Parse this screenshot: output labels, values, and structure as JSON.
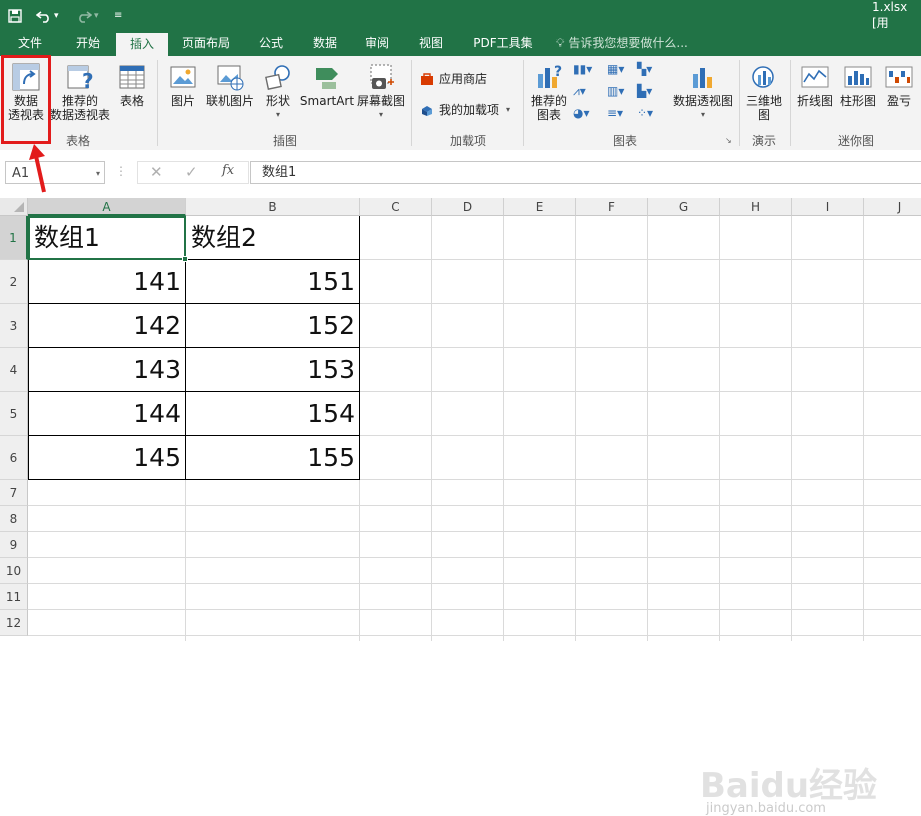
{
  "title_bar": {
    "filename": "1.xlsx [用"
  },
  "tabs": [
    {
      "label": "文件"
    },
    {
      "label": "开始"
    },
    {
      "label": "插入"
    },
    {
      "label": "页面布局"
    },
    {
      "label": "公式"
    },
    {
      "label": "数据"
    },
    {
      "label": "审阅"
    },
    {
      "label": "视图"
    },
    {
      "label": "PDF工具集"
    }
  ],
  "tell_me": "告诉我您想要做什么...",
  "ribbon": {
    "pivot_table": {
      "line1": "数据",
      "line2": "透视表"
    },
    "recommended_pivot": {
      "line1": "推荐的",
      "line2": "数据透视表"
    },
    "table": "表格",
    "group_tables": "表格",
    "picture": "图片",
    "online_picture": "联机图片",
    "shapes": "形状",
    "smartart": "SmartArt",
    "screenshot": "屏幕截图",
    "group_illustrations": "插图",
    "store": "应用商店",
    "my_addins": "我的加载项",
    "group_addins": "加载项",
    "recommended_charts": {
      "line1": "推荐的",
      "line2": "图表"
    },
    "pivot_chart": "数据透视图",
    "group_charts": "图表",
    "map_3d": "三维地",
    "map_3d_line2": "图",
    "group_tours": "演示",
    "line_spark": "折线图",
    "column_spark": "柱形图",
    "winloss_spark": "盈亏",
    "group_sparklines": "迷你图"
  },
  "formula_bar": {
    "name_box": "A1",
    "fx": "fx",
    "content": "数组1"
  },
  "columns": [
    "A",
    "B",
    "C",
    "D",
    "E",
    "F",
    "G",
    "H",
    "I",
    "J"
  ],
  "rows": [
    "1",
    "2",
    "3",
    "4",
    "5",
    "6",
    "7",
    "8",
    "9",
    "10",
    "11",
    "12"
  ],
  "cells": {
    "A1": "数组1",
    "B1": "数组2",
    "A2": "141",
    "B2": "151",
    "A3": "142",
    "B3": "152",
    "A4": "143",
    "B4": "153",
    "A5": "144",
    "B5": "154",
    "A6": "145",
    "B6": "155"
  },
  "watermark": {
    "main": "Baidu经验",
    "sub": "jingyan.baidu.com"
  },
  "colors": {
    "excel_green": "#217346",
    "highlight_red": "#e21b1b"
  }
}
